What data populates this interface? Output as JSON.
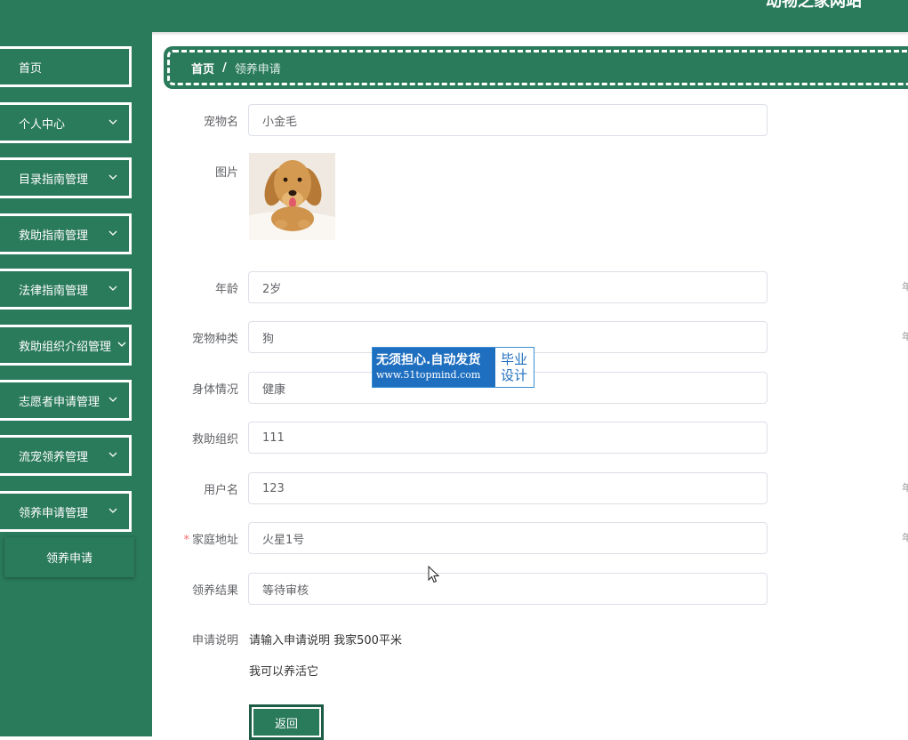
{
  "header": {
    "site_title": "动物之家网站"
  },
  "sidebar": {
    "items": [
      {
        "label": "首页",
        "has_chevron": false
      },
      {
        "label": "个人中心",
        "has_chevron": true
      },
      {
        "label": "目录指南管理",
        "has_chevron": true
      },
      {
        "label": "救助指南管理",
        "has_chevron": true
      },
      {
        "label": "法律指南管理",
        "has_chevron": true
      },
      {
        "label": "救助组织介绍管理",
        "has_chevron": true
      },
      {
        "label": "志愿者申请管理",
        "has_chevron": true
      },
      {
        "label": "流宠领养管理",
        "has_chevron": true
      },
      {
        "label": "领养申请管理",
        "has_chevron": true
      }
    ],
    "submenu": {
      "label": "领养申请"
    }
  },
  "breadcrumb": {
    "home": "首页",
    "separator": "/",
    "current": "领养申请"
  },
  "form": {
    "pet_name": {
      "label": "宠物名",
      "value": "小金毛"
    },
    "image": {
      "label": "图片"
    },
    "age": {
      "label": "年龄",
      "value": "2岁"
    },
    "pet_type": {
      "label": "宠物种类",
      "value": "狗"
    },
    "health": {
      "label": "身体情况",
      "value": "健康"
    },
    "rescue_org": {
      "label": "救助组织",
      "value": "111"
    },
    "username": {
      "label": "用户名",
      "value": "123"
    },
    "address": {
      "label": "家庭地址",
      "value": "火星1号",
      "required_mark": "*"
    },
    "result": {
      "label": "领养结果",
      "value": "等待审核"
    },
    "description": {
      "label": "申请说明",
      "line1": "请输入申请说明 我家500平米",
      "line2": "我可以养活它"
    }
  },
  "buttons": {
    "back": "返回"
  },
  "watermark": {
    "line1": "无须担心.自动发货",
    "line2": "www.51topmind.com",
    "right_top": "毕业",
    "right_bottom": "设计"
  },
  "colors": {
    "primary": "#2a7a5c",
    "required": "#f56c6c",
    "watermark_blue": "#1f6fc0"
  },
  "icons": {
    "chevron": "chevron-down-icon",
    "cursor": "mouse-pointer-icon"
  }
}
